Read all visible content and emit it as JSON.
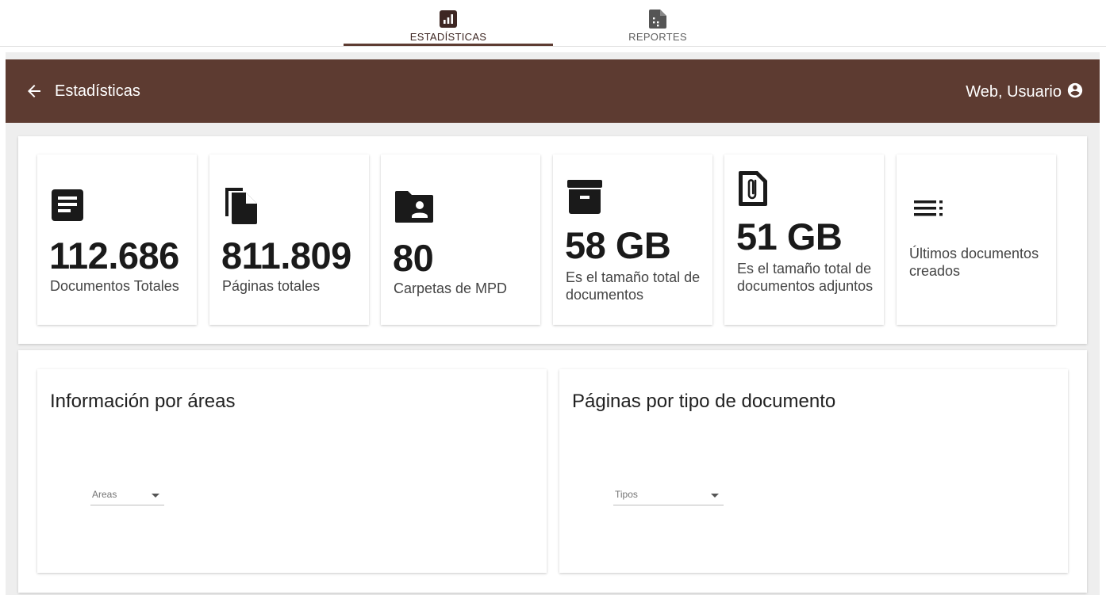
{
  "tabs": [
    {
      "label": "ESTADÍSTICAS",
      "icon": "bar-chart-icon",
      "active": true
    },
    {
      "label": "REPORTES",
      "icon": "report-file-icon",
      "active": false
    }
  ],
  "header": {
    "title": "Estadísticas",
    "user": "Web, Usuario",
    "back_icon": "arrow-back-icon",
    "user_icon": "account-circle-icon"
  },
  "stats": [
    {
      "icon": "document-icon",
      "value": "112.686",
      "label": "Documentos Totales"
    },
    {
      "icon": "copy-pages-icon",
      "value": "811.809",
      "label": "Páginas totales"
    },
    {
      "icon": "folder-user-icon",
      "value": "80",
      "label": "Carpetas de MPD"
    },
    {
      "icon": "archive-box-icon",
      "value": "58 GB",
      "label": "Es el tamaño total de documentos"
    },
    {
      "icon": "attachment-file-icon",
      "value": "51 GB",
      "label": "Es el tamaño total de documentos adjuntos"
    },
    {
      "icon": "list-icon",
      "value": "",
      "label": "Últimos documentos creados"
    }
  ],
  "charts": [
    {
      "title": "Información por áreas",
      "select_placeholder": "Areas"
    },
    {
      "title": "Páginas por tipo de documento",
      "select_placeholder": "Tipos"
    }
  ],
  "colors": {
    "header_bg": "#5d3b31",
    "accent": "#5d3b31",
    "stage_bg": "#eeeeee"
  }
}
